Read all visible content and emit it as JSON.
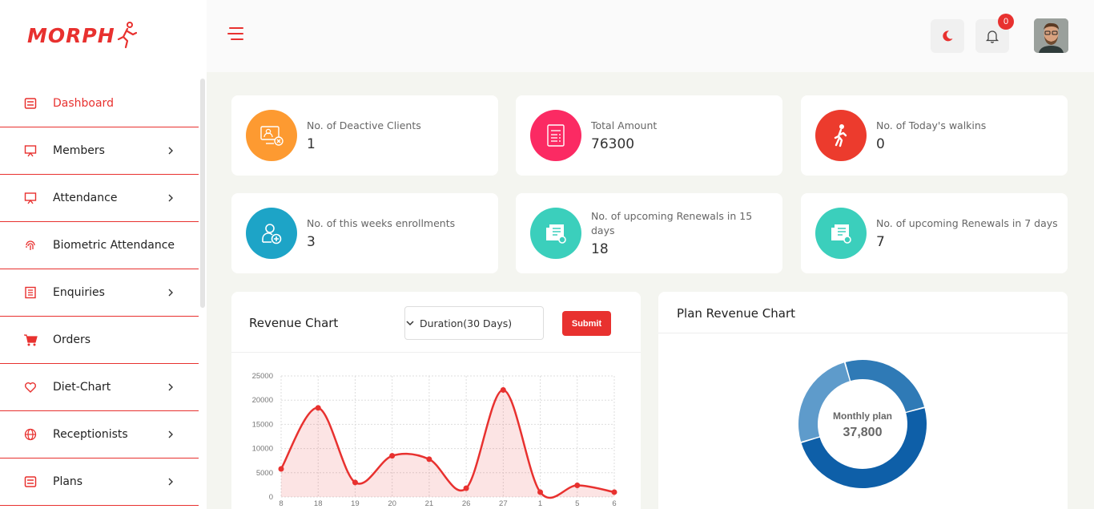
{
  "brand": {
    "logo_text": "MORPH"
  },
  "sidebar": {
    "items": [
      {
        "label": "Dashboard",
        "icon": "dashboard-icon",
        "active": true,
        "has_children": false
      },
      {
        "label": "Members",
        "icon": "monitor-icon",
        "active": false,
        "has_children": true
      },
      {
        "label": "Attendance",
        "icon": "monitor-icon",
        "active": false,
        "has_children": true
      },
      {
        "label": "Biometric Attendance",
        "icon": "fingerprint-icon",
        "active": false,
        "has_children": false
      },
      {
        "label": "Enquiries",
        "icon": "clipboard-icon",
        "active": false,
        "has_children": true
      },
      {
        "label": "Orders",
        "icon": "cart-icon",
        "active": false,
        "has_children": false
      },
      {
        "label": "Diet-Chart",
        "icon": "heart-icon",
        "active": false,
        "has_children": true
      },
      {
        "label": "Receptionists",
        "icon": "globe-icon",
        "active": false,
        "has_children": true
      },
      {
        "label": "Plans",
        "icon": "plans-icon",
        "active": false,
        "has_children": true
      }
    ]
  },
  "header": {
    "notification_count": "0"
  },
  "stats": [
    {
      "label": "No. of Deactive Clients",
      "value": "1",
      "color": "#fd9a31",
      "icon": "deactive-user-icon"
    },
    {
      "label": "Total Amount",
      "value": "76300",
      "color": "#fb2a63",
      "icon": "invoice-icon"
    },
    {
      "label": "No. of Today's walkins",
      "value": "0",
      "color": "#ec3b2d",
      "icon": "walking-icon"
    },
    {
      "label": "No. of this weeks enrollments",
      "value": "3",
      "color": "#1da4c7",
      "icon": "add-user-icon"
    },
    {
      "label": "No. of upcoming Renewals in 15 days",
      "value": "18",
      "color": "#3bcfbc",
      "icon": "renewal-icon"
    },
    {
      "label": "No. of upcoming Renewals in 7 days",
      "value": "7",
      "color": "#3bcfbc",
      "icon": "renewal-icon"
    }
  ],
  "revenue": {
    "title": "Revenue Chart",
    "duration_label": "Duration(30 Days)",
    "submit_label": "Submit"
  },
  "plan": {
    "title": "Plan Revenue Chart",
    "center_label": "Monthly plan",
    "center_value": "37,800"
  },
  "chart_data": [
    {
      "type": "area",
      "title": "Revenue Chart",
      "categories": [
        "8",
        "18",
        "19",
        "20",
        "21",
        "26",
        "27",
        "1",
        "5",
        "6"
      ],
      "values": [
        5800,
        18400,
        3000,
        8500,
        7800,
        1800,
        22100,
        1000,
        2400,
        1000
      ],
      "ylim": [
        0,
        25000
      ],
      "yticks": [
        0,
        5000,
        10000,
        15000,
        20000,
        25000
      ],
      "grid": true,
      "color": "#e8312f"
    },
    {
      "type": "pie",
      "title": "Plan Revenue Chart",
      "labels": [
        "Monthly plan"
      ],
      "values": [
        37800,
        19200,
        19300
      ],
      "colors": [
        "#0e5fa8",
        "#5e9bcb",
        "#2f7ab6"
      ],
      "donut": true
    }
  ]
}
